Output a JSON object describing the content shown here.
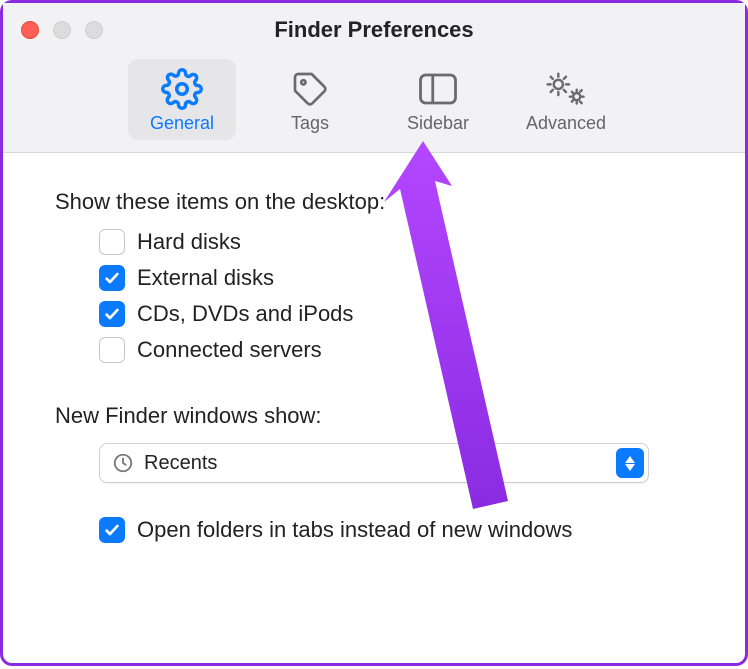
{
  "window": {
    "title": "Finder Preferences"
  },
  "tabs": [
    {
      "label": "General"
    },
    {
      "label": "Tags"
    },
    {
      "label": "Sidebar"
    },
    {
      "label": "Advanced"
    }
  ],
  "section_desktop": {
    "label": "Show these items on the desktop:"
  },
  "desktop_items": [
    {
      "label": "Hard disks",
      "checked": false
    },
    {
      "label": "External disks",
      "checked": true
    },
    {
      "label": "CDs, DVDs and iPods",
      "checked": true
    },
    {
      "label": "Connected servers",
      "checked": false
    }
  ],
  "section_new_windows": {
    "label": "New Finder windows show:"
  },
  "dropdown": {
    "selected": "Recents"
  },
  "open_in_tabs": {
    "label": "Open folders in tabs instead of new windows",
    "checked": true
  }
}
